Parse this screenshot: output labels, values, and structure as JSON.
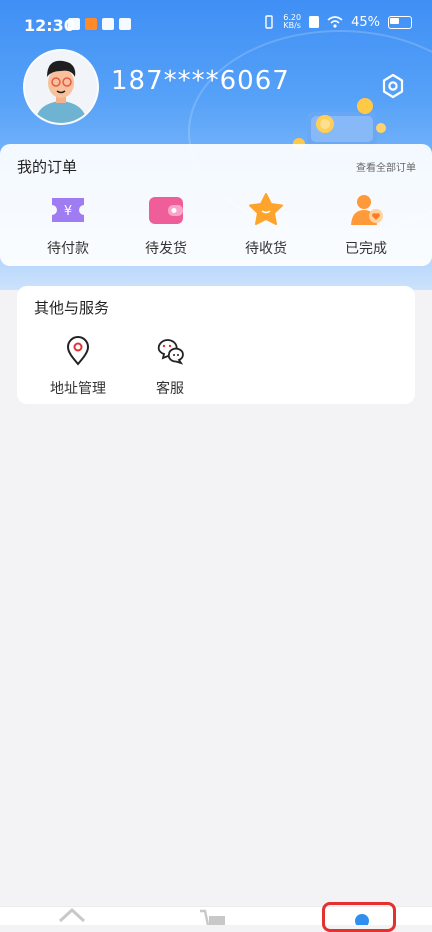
{
  "status_bar": {
    "time": "12:30",
    "net_speed_value": "6.20",
    "net_speed_unit": "KB/s",
    "battery": "45%"
  },
  "profile": {
    "phone": "187****6067"
  },
  "orders": {
    "title": "我的订单",
    "view_all": "查看全部订单",
    "items": [
      {
        "label": "待付款",
        "icon": "yen-ticket-icon"
      },
      {
        "label": "待发货",
        "icon": "wallet-icon"
      },
      {
        "label": "待收货",
        "icon": "star-icon"
      },
      {
        "label": "已完成",
        "icon": "user-heart-icon"
      }
    ]
  },
  "services": {
    "title": "其他与服务",
    "items": [
      {
        "label": "地址管理",
        "icon": "location-pin-icon"
      },
      {
        "label": "客服",
        "icon": "chat-bubbles-icon"
      }
    ]
  },
  "colors": {
    "accent": "#3f8ff5",
    "active_tab": "#2f8ff0",
    "highlight_box": "#e53030"
  }
}
